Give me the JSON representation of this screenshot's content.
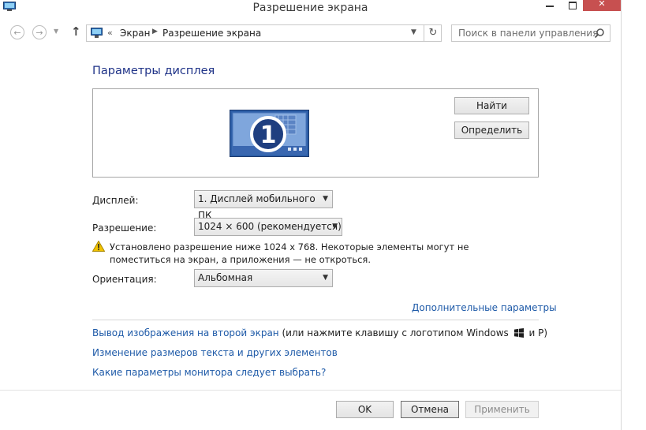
{
  "window": {
    "title": "Разрешение экрана",
    "icon": "display-control-panel-icon"
  },
  "address_bar": {
    "chevron": "«",
    "crumbs": [
      "Экран",
      "Разрешение экрана"
    ],
    "search_placeholder": "Поиск в панели управления"
  },
  "main": {
    "heading": "Параметры дисплея",
    "monitor_number": "1",
    "find_button": "Найти",
    "identify_button": "Определить",
    "display_label": "Дисплей:",
    "display_value": "1. Дисплей мобильного ПК",
    "resolution_label": "Разрешение:",
    "resolution_value": "1024 × 600 (рекомендуется)",
    "warning_text": "Установлено разрешение ниже 1024 x 768. Некоторые элементы могут не поместиться на экран, а приложения — не откроться.",
    "orientation_label": "Ориентация:",
    "orientation_value": "Альбомная",
    "advanced_link": "Дополнительные параметры",
    "second_screen_link": "Вывод изображения на второй экран",
    "second_screen_hint_before": "(или нажмите клавишу с логотипом Windows",
    "second_screen_hint_after": "и P)",
    "text_size_link": "Изменение размеров текста и других элементов",
    "monitor_params_link": "Какие параметры монитора следует выбрать?"
  },
  "footer": {
    "ok": "OK",
    "cancel": "Отмена",
    "apply": "Применить"
  },
  "colors": {
    "link": "#1e5aa8",
    "heading": "#1e3287",
    "close_button": "#c75050",
    "monitor_blue": "#2e5fa8"
  }
}
